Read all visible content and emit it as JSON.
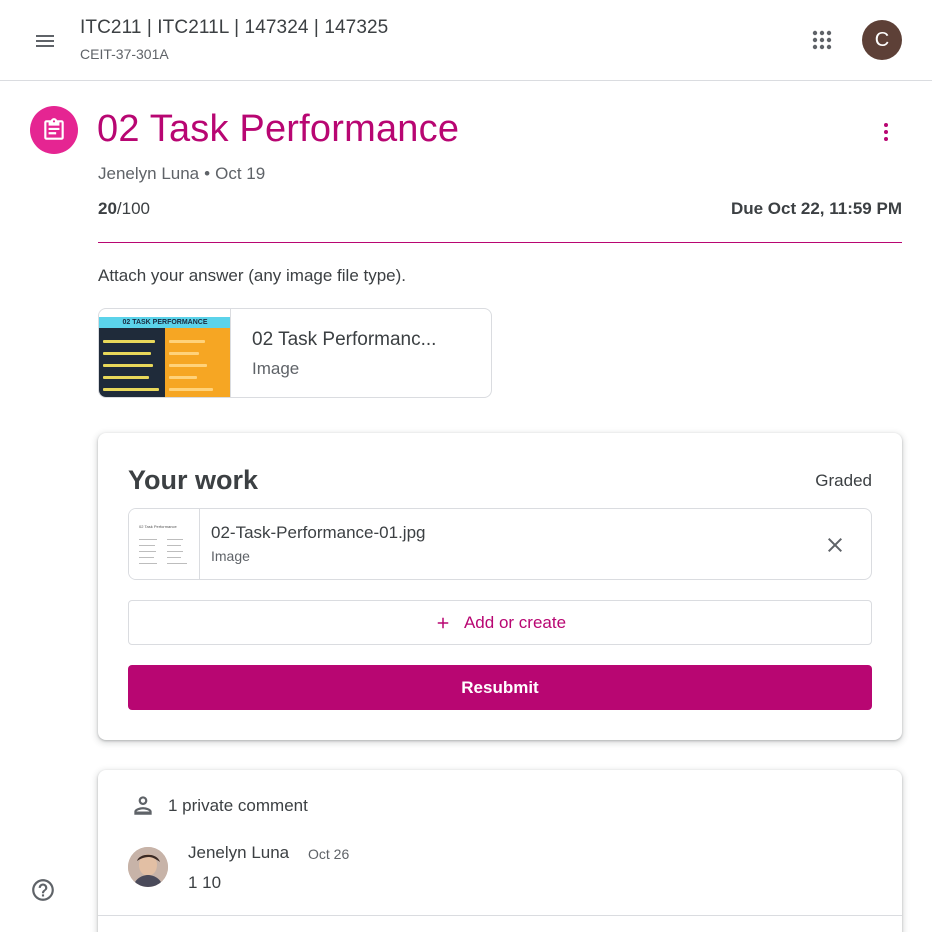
{
  "header": {
    "course_title": "ITC211 | ITC211L | 147324 | 147325",
    "course_section": "CEIT-37-301A",
    "menu_icon": "hamburger-menu-icon",
    "apps_icon": "apps-grid-icon",
    "avatar_letter": "C",
    "avatar_color": "#5d4037"
  },
  "assignment": {
    "icon": "assignment-icon",
    "title": "02 Task Performance",
    "author": "Jenelyn Luna",
    "separator": "•",
    "posted_date": "Oct 19",
    "points_earned": "20",
    "points_total": "/100",
    "due": "Due Oct 22, 11:59 PM",
    "instructions": "Attach your answer (any image file type).",
    "accent_color": "#b80672",
    "icon_bg_color": "#e52592"
  },
  "attachment": {
    "name": "02 Task Performanc...",
    "type": "Image",
    "thumb_banner": "02 TASK PERFORMANCE"
  },
  "your_work": {
    "title": "Your work",
    "status": "Graded",
    "file": {
      "name": "02-Task-Performance-01.jpg",
      "type": "Image",
      "thumb_title": "02 Task Performance"
    },
    "add_label": "Add or create",
    "resubmit_label": "Resubmit"
  },
  "comments": {
    "header": "1 private comment",
    "items": [
      {
        "author": "Jenelyn Luna",
        "date": "Oct 26",
        "text": "1 10"
      }
    ]
  },
  "help_icon": "help-circle-icon"
}
